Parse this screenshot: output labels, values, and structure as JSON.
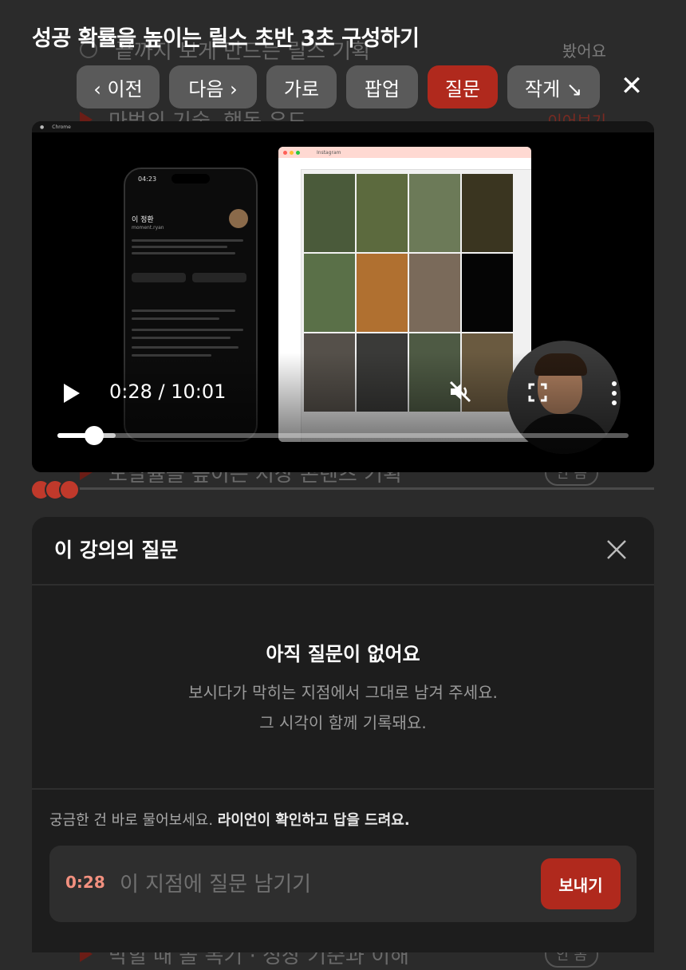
{
  "page_title": "성공 확률을 높이는 릴스 초반 3초 구성하기",
  "background": {
    "rows": [
      {
        "text": "끝까지 보게 만드는 릴스 기획",
        "right": "봤어요",
        "kind": "done"
      },
      {
        "text": "마법의 기술, 행동 유도",
        "right": "이어보기",
        "kind": "current"
      },
      {
        "text": "도달률을 높이는 저장 콘텐츠 기획",
        "right": "안 봄",
        "kind": "pending"
      },
      {
        "text": "막힐 때 볼 복기 · 성장 기준과 이해",
        "right": "안 봄",
        "kind": "pending"
      }
    ]
  },
  "toolbar": {
    "prev": "‹ 이전",
    "next": "다음 ›",
    "landscape": "가로",
    "popup": "팝업",
    "question": "질문",
    "small": "작게 ↘",
    "close": "✕"
  },
  "video": {
    "time_label": "0:28 / 10:01",
    "progress": 0.064,
    "buffered": 0.102,
    "muted": true,
    "screen": {
      "os_app": "Chrome",
      "phone_time": "04:23",
      "profile_name": "이 정환",
      "profile_handle": "moment.ryan",
      "browser_tab": "Instagram"
    }
  },
  "panel": {
    "title": "이 강의의 질문",
    "empty_title": "아직 질문이 없어요",
    "empty_line1": "보시다가 막히는 지점에서 그대로 남겨 주세요.",
    "empty_line2": "그 시각이 함께 기록돼요.",
    "prompt_plain": "궁금한 건 바로 물어보세요.",
    "prompt_bold": "라이언이 확인하고 답을 드려요.",
    "timestamp": "0:28",
    "input_placeholder": "이 지점에 질문 남기기",
    "send_label": "보내기"
  },
  "colors": {
    "accent": "#b0291d",
    "timestamp": "#f2907f",
    "panel_bg": "#1d1d1d"
  }
}
